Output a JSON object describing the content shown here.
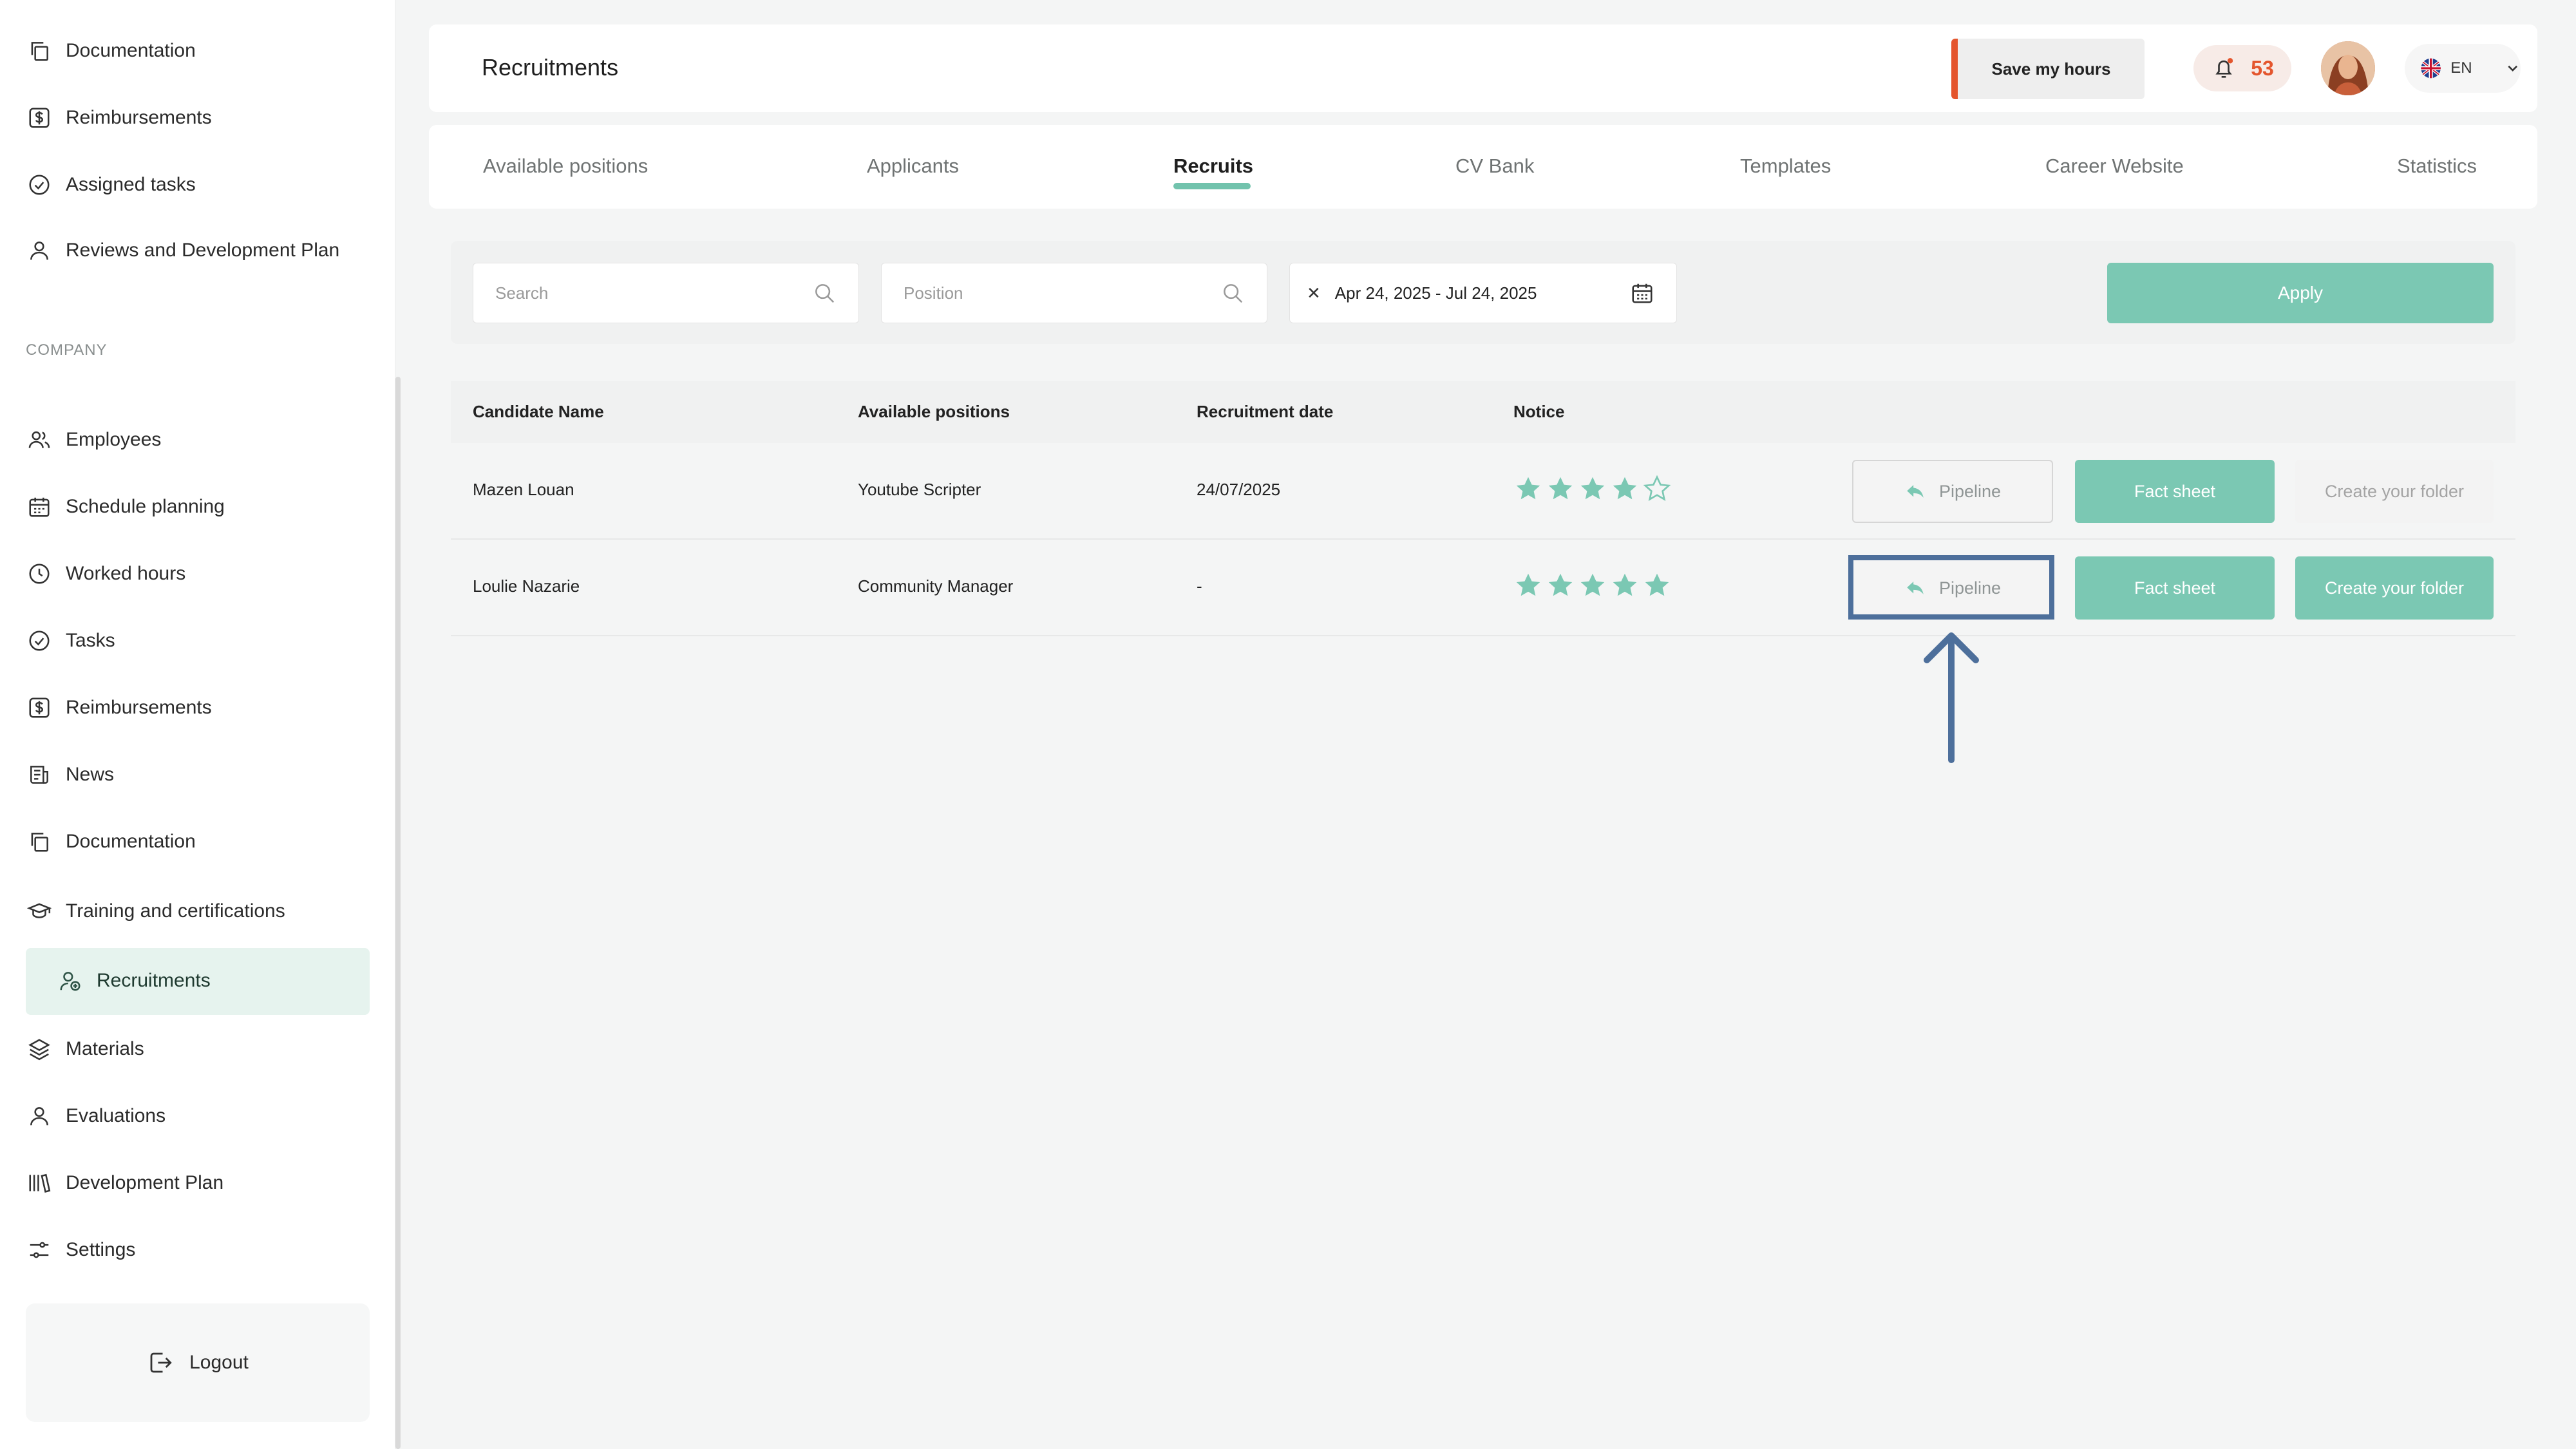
{
  "sidebar": {
    "items_top": [
      {
        "label": "Documentation",
        "icon": "copy-icon"
      },
      {
        "label": "Reimbursements",
        "icon": "dollar-icon"
      },
      {
        "label": "Assigned tasks",
        "icon": "check-circle-icon"
      },
      {
        "label": "Reviews and Development Plan",
        "icon": "user-icon"
      }
    ],
    "section_label": "COMPANY",
    "items": [
      {
        "label": "Employees",
        "icon": "users-icon"
      },
      {
        "label": "Schedule planning",
        "icon": "calendar-icon"
      },
      {
        "label": "Worked hours",
        "icon": "clock-icon"
      },
      {
        "label": "Tasks",
        "icon": "check-circle-icon"
      },
      {
        "label": "Reimbursements",
        "icon": "dollar-icon"
      },
      {
        "label": "News",
        "icon": "newspaper-icon"
      },
      {
        "label": "Documentation",
        "icon": "copy-icon"
      },
      {
        "label": "Training and certifications",
        "icon": "graduation-cap-icon"
      },
      {
        "label": "Recruitments",
        "icon": "user-add-icon"
      },
      {
        "label": "Materials",
        "icon": "layers-icon"
      },
      {
        "label": "Evaluations",
        "icon": "user-icon"
      },
      {
        "label": "Development Plan",
        "icon": "books-icon"
      },
      {
        "label": "Settings",
        "icon": "sliders-icon"
      }
    ],
    "active_item": "Recruitments",
    "logout_label": "Logout"
  },
  "header": {
    "title": "Recruitments",
    "save_hours_label": "Save my hours",
    "notification_count": "53",
    "language": "EN"
  },
  "tabs": [
    {
      "label": "Available positions"
    },
    {
      "label": "Applicants"
    },
    {
      "label": "Recruits"
    },
    {
      "label": "CV Bank"
    },
    {
      "label": "Templates"
    },
    {
      "label": "Career Website"
    },
    {
      "label": "Statistics"
    }
  ],
  "active_tab": "Recruits",
  "filters": {
    "search_placeholder": "Search",
    "position_placeholder": "Position",
    "date_range": "Apr 24, 2025 - Jul 24, 2025",
    "apply_label": "Apply"
  },
  "table": {
    "columns": [
      "Candidate Name",
      "Available positions",
      "Recruitment date",
      "Notice"
    ],
    "rows": [
      {
        "name": "Mazen Louan",
        "position": "Youtube Scripter",
        "date": "24/07/2025",
        "rating": 4,
        "pipeline_label": "Pipeline",
        "fact_label": "Fact sheet",
        "folder_label": "Create your folder",
        "folder_enabled": false
      },
      {
        "name": "Loulie Nazarie",
        "position": "Community Manager",
        "date": "-",
        "rating": 5,
        "pipeline_label": "Pipeline",
        "fact_label": "Fact sheet",
        "folder_label": "Create your folder",
        "folder_enabled": true
      }
    ]
  },
  "colors": {
    "accent": "#7bc8b3",
    "alert": "#e4552d",
    "highlight": "#4d6f9b"
  }
}
